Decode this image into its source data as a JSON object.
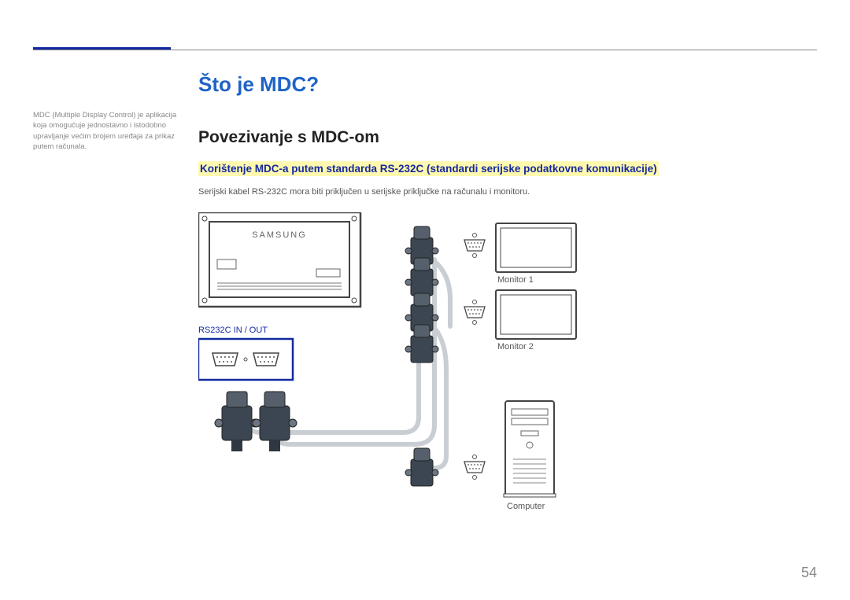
{
  "sidebar_note": "MDC (Multiple Display Control) je aplikacija koja omogućuje jednostavno i istodobno upravljanje većim brojem uređaja za prikaz putem računala.",
  "h1": "Što je MDC?",
  "h2": "Povezivanje s MDC-om",
  "highlight": "Korištenje MDC-a putem standarda RS-232C (standardi serijske podatkovne komunikacije)",
  "body": "Serijski kabel RS-232C mora biti priključen u serijske priključke na računalu i monitoru.",
  "diagram": {
    "port_label": "RS232C IN / OUT",
    "monitor1": "Monitor 1",
    "monitor2": "Monitor 2",
    "computer": "Computer",
    "device_brand": "SAMSUNG"
  },
  "page_number": "54"
}
